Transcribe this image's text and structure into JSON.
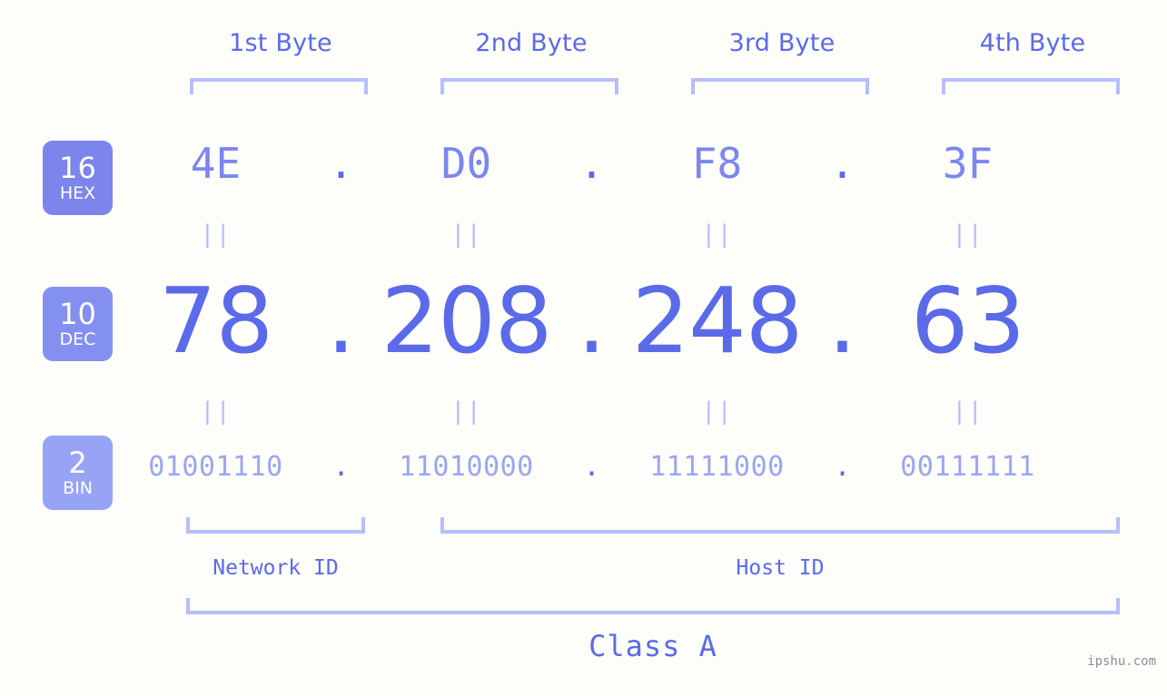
{
  "page": {
    "background_color": "#fdfdfa",
    "accent_color": "#5b6ae8",
    "light_accent_color": "#b6bffa",
    "watermark": "ipshu.com"
  },
  "byte_headers": [
    {
      "label": "1st Byte"
    },
    {
      "label": "2nd Byte"
    },
    {
      "label": "3rd Byte"
    },
    {
      "label": "4th Byte"
    }
  ],
  "bases": [
    {
      "number": "16",
      "name": "HEX",
      "color": "#7b85eb"
    },
    {
      "number": "10",
      "name": "DEC",
      "color": "#8490f0"
    },
    {
      "number": "2",
      "name": "BIN",
      "color": "#97a4f5"
    }
  ],
  "separator": ".",
  "equals_marker": "||",
  "rows": {
    "hex": {
      "values": [
        "4E",
        "D0",
        "F8",
        "3F"
      ]
    },
    "dec": {
      "values": [
        "78",
        "208",
        "248",
        "63"
      ]
    },
    "bin": {
      "values": [
        "01001110",
        "11010000",
        "11111000",
        "00111111"
      ]
    }
  },
  "segments": {
    "network_id": "Network ID",
    "host_id": "Host ID"
  },
  "class_label": "Class A",
  "address": {
    "hex": "4E.D0.F8.3F",
    "dec": "78.208.248.63",
    "bin": "01001110.11010000.11111000.00111111"
  }
}
